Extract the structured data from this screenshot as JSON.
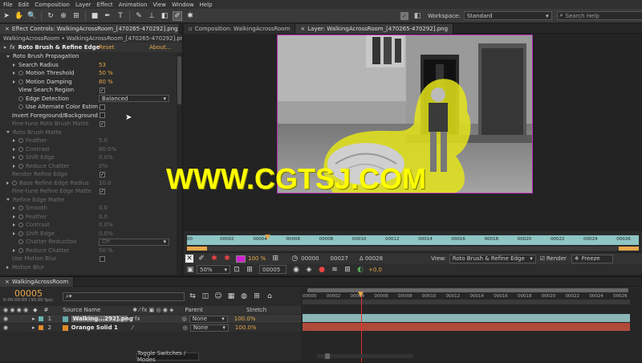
{
  "menu": [
    "File",
    "Edit",
    "Composition",
    "Layer",
    "Effect",
    "Animation",
    "View",
    "Window",
    "Help"
  ],
  "workspace": {
    "label": "Workspace:",
    "value": "Standard",
    "search_placeholder": "Search Help"
  },
  "effect_controls": {
    "tab": "Effect Controls: WalkingAcrossRoom_[470265-470292].png",
    "breadcrumb": "WalkingAcrossRoom • WalkingAcrossRoom_[470265-470292].png",
    "effect_name": "Roto Brush & Refine Edge",
    "reset": "Reset",
    "about": "About...",
    "rows": [
      {
        "label": "Roto Brush Propagation",
        "indent": 1,
        "tri": "down",
        "dim": false
      },
      {
        "label": "Search Radius",
        "indent": 2,
        "tri": "right",
        "value": "53",
        "dim": false
      },
      {
        "label": "Motion Threshold",
        "indent": 2,
        "tri": "right",
        "sw": true,
        "value": "50 %",
        "dim": false
      },
      {
        "label": "Motion Damping",
        "indent": 2,
        "tri": "right",
        "sw": true,
        "value": "80 %",
        "dim": false
      },
      {
        "label": "View Search Region",
        "indent": 2,
        "check": "✓",
        "dim": false
      },
      {
        "label": "Edge Detection",
        "indent": 2,
        "sw": true,
        "dropdown": "Balanced",
        "dim": false
      },
      {
        "label": "Use Alternate Color Estim",
        "indent": 2,
        "sw": true,
        "check": "",
        "dim": false
      },
      {
        "label": "Invert Foreground/Background",
        "indent": 1,
        "check": "",
        "dim": false
      },
      {
        "label": "Fine-tune Roto Brush Matte",
        "indent": 1,
        "check": "✓",
        "dim": true
      },
      {
        "label": "Roto Brush Matte",
        "indent": 1,
        "tri": "down",
        "dim": true
      },
      {
        "label": "Feather",
        "indent": 2,
        "tri": "right",
        "sw": true,
        "value": "5.0",
        "dim": true
      },
      {
        "label": "Contrast",
        "indent": 2,
        "tri": "right",
        "sw": true,
        "value": "80.0%",
        "dim": true
      },
      {
        "label": "Shift Edge",
        "indent": 2,
        "tri": "right",
        "sw": true,
        "value": "0.0%",
        "dim": true
      },
      {
        "label": "Reduce Chatter",
        "indent": 2,
        "tri": "right",
        "sw": true,
        "value": "0%",
        "dim": true
      },
      {
        "label": "Render Refine Edge",
        "indent": 1,
        "check": "✓",
        "dim": true
      },
      {
        "label": "Base Refine Edge Radius",
        "indent": 1,
        "tri": "right",
        "sw": true,
        "value": "10.0",
        "dim": true
      },
      {
        "label": "Fine-tune Refine Edge Matte",
        "indent": 1,
        "check": "✓",
        "dim": true
      },
      {
        "label": "Refine Edge Matte",
        "indent": 1,
        "tri": "down",
        "dim": true
      },
      {
        "label": "Smooth",
        "indent": 2,
        "tri": "right",
        "sw": true,
        "value": "0.0",
        "dim": true
      },
      {
        "label": "Feather",
        "indent": 2,
        "tri": "right",
        "sw": true,
        "value": "0.0",
        "dim": true
      },
      {
        "label": "Contrast",
        "indent": 2,
        "tri": "right",
        "sw": true,
        "value": "0.0%",
        "dim": true
      },
      {
        "label": "Shift Edge",
        "indent": 2,
        "tri": "right",
        "sw": true,
        "value": "0.0%",
        "dim": true
      },
      {
        "label": "Chatter Reduction",
        "indent": 2,
        "sw": true,
        "dropdown": "Off",
        "dim": true
      },
      {
        "label": "Reduce Chatter",
        "indent": 2,
        "tri": "right",
        "sw": true,
        "value": "50 %",
        "dim": true
      },
      {
        "label": "Use Motion Blur",
        "indent": 1,
        "check": "",
        "dim": true
      },
      {
        "label": "Motion Blur",
        "indent": 1,
        "tri": "right",
        "dim": true
      }
    ]
  },
  "comp": {
    "tab1": "Composition: WalkingAcrossRoom",
    "tab2": "Layer: WalkingAcrossRoom_[470265-470292].png",
    "ruler": [
      "00",
      "00002",
      "00004",
      "00006",
      "00008",
      "00010",
      "00012",
      "00014",
      "00016",
      "00018",
      "00020",
      "00022",
      "00024",
      "00026"
    ],
    "start": "00000",
    "end": "00027",
    "duration": "Δ 00028",
    "view_label": "View:",
    "view_value": "Roto Brush & Refine Edge",
    "render": "Render",
    "freeze": "Freeze",
    "zoom": "50%",
    "frame": "00005",
    "res_pct": "100 %",
    "exposure": "+0.0"
  },
  "timeline": {
    "tab": "WalkingAcrossRoom",
    "timecode": "00005",
    "timecode_sub": "0:00:00:05 (30.00 fps)",
    "headers": {
      "num": "#",
      "source": "Source Name",
      "parent": "Parent",
      "stretch": "Stretch"
    },
    "layers": [
      {
        "num": "1",
        "name": "Walking...292].png",
        "parent": "None",
        "stretch": "100.0%",
        "color": "#6ab4b4"
      },
      {
        "num": "2",
        "name": "Orange Solid 1",
        "parent": "None",
        "stretch": "100.0%",
        "color": "#e08a2a"
      }
    ],
    "ruler": [
      "00000",
      "00002",
      "00004",
      "00006",
      "00008",
      "00010",
      "00012",
      "00014",
      "00016",
      "00018",
      "00020",
      "00022",
      "00024",
      "00026"
    ],
    "toggle": "Toggle Switches / Modes"
  },
  "watermark": "WWW.CGTSJ.COM",
  "colors": {
    "accent": "#e8a84b",
    "matte": "#ffff00",
    "comp_border": "#b22bb2"
  }
}
